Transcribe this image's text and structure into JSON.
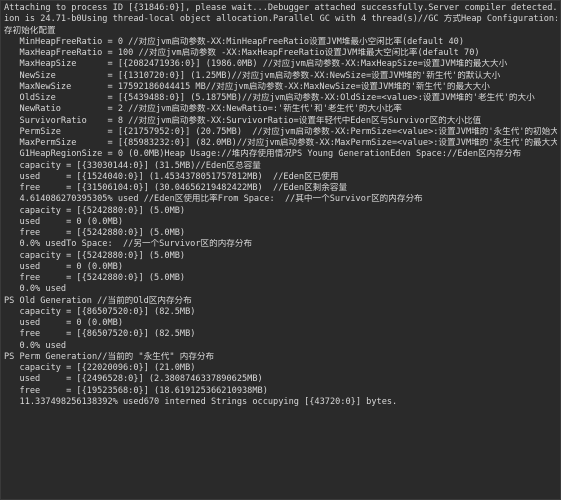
{
  "console": {
    "lines": [
      "Attaching to process ID [{31846:0}], please wait...Debugger attached successfully.Server compiler detected.JVM vers",
      "ion is 24.71-b0Using thread-local object allocation.Parallel GC with 4 thread(s)//GC 方式Heap Configuration: //堆内",
      "存初始化配置",
      "   MinHeapFreeRatio = 0 //对应jvm启动参数-XX:MinHeapFreeRatio设置JVM堆最小空闲比率(default 40)",
      "   MaxHeapFreeRatio = 100 //对应jvm启动参数 -XX:MaxHeapFreeRatio设置JVM堆最大空闲比率(default 70)",
      "   MaxHeapSize      = [{2082471936:0}] (1986.0MB) //对应jvm启动参数-XX:MaxHeapSize=设置JVM堆的最大大小",
      "   NewSize          = [{1310720:0}] (1.25MB)//对应jvm启动参数-XX:NewSize=设置JVM堆的'新生代'的默认大小",
      "   MaxNewSize       = 17592186044415 MB//对应jvm启动参数-XX:MaxNewSize=设置JVM堆的'新生代'的最大大小",
      "   OldSize          = [{5439488:0}] (5.1875MB)//对应jvm启动参数-XX:OldSize=<value>:设置JVM堆的'老生代'的大小",
      "   NewRatio         = 2 //对应jvm启动参数-XX:NewRatio=:'新生代'和'老生代'的大小比率",
      "   SurvivorRatio    = 8 //对应jvm启动参数-XX:SurvivorRatio=设置年轻代中Eden区与Survivor区的大小比值",
      "   PermSize         = [{21757952:0}] (20.75MB)  //对应jvm启动参数-XX:PermSize=<value>:设置JVM堆的'永生代'的初始大小",
      "   MaxPermSize      = [{85983232:0}] (82.0MB)//对应jvm启动参数-XX:MaxPermSize=<value>:设置JVM堆的'永生代'的最大大小",
      "   G1HeapRegionSize = 0 (0.0MB)Heap Usage://堆内存使用情况PS Young GenerationEden Space://Eden区内存分布",
      "   capacity = [{33030144:0}] (31.5MB)//Eden区总容量",
      "   used     = [{1524040:0}] (1.4534378051757812MB)  //Eden区已使用",
      "   free     = [{31506104:0}] (30.04656219482422MB)  //Eden区剩余容量",
      "   4.614086270395305% used //Eden区使用比率From Space:  //其中一个Survivor区的内存分布",
      "   capacity = [{5242880:0}] (5.0MB)",
      "   used     = 0 (0.0MB)",
      "   free     = [{5242880:0}] (5.0MB)",
      "   0.0% usedTo Space:  //另一个Survivor区的内存分布",
      "   capacity = [{5242880:0}] (5.0MB)",
      "   used     = 0 (0.0MB)",
      "   free     = [{5242880:0}] (5.0MB)",
      "   0.0% used",
      "PS Old Generation //当前的Old区内存分布",
      "   capacity = [{86507520:0}] (82.5MB)",
      "   used     = 0 (0.0MB)",
      "   free     = [{86507520:0}] (82.5MB)",
      "   0.0% used",
      "PS Perm Generation//当前的 \"永生代\" 内存分布",
      "   capacity = [{22020096:0}] (21.0MB)",
      "   used     = [{2496528:0}] (2.3808746337890625MB)",
      "   free     = [{19523568:0}] (18.619125366210938MB)",
      "   11.337498256138392% used670 interned Strings occupying [{43720:0}] bytes."
    ]
  }
}
